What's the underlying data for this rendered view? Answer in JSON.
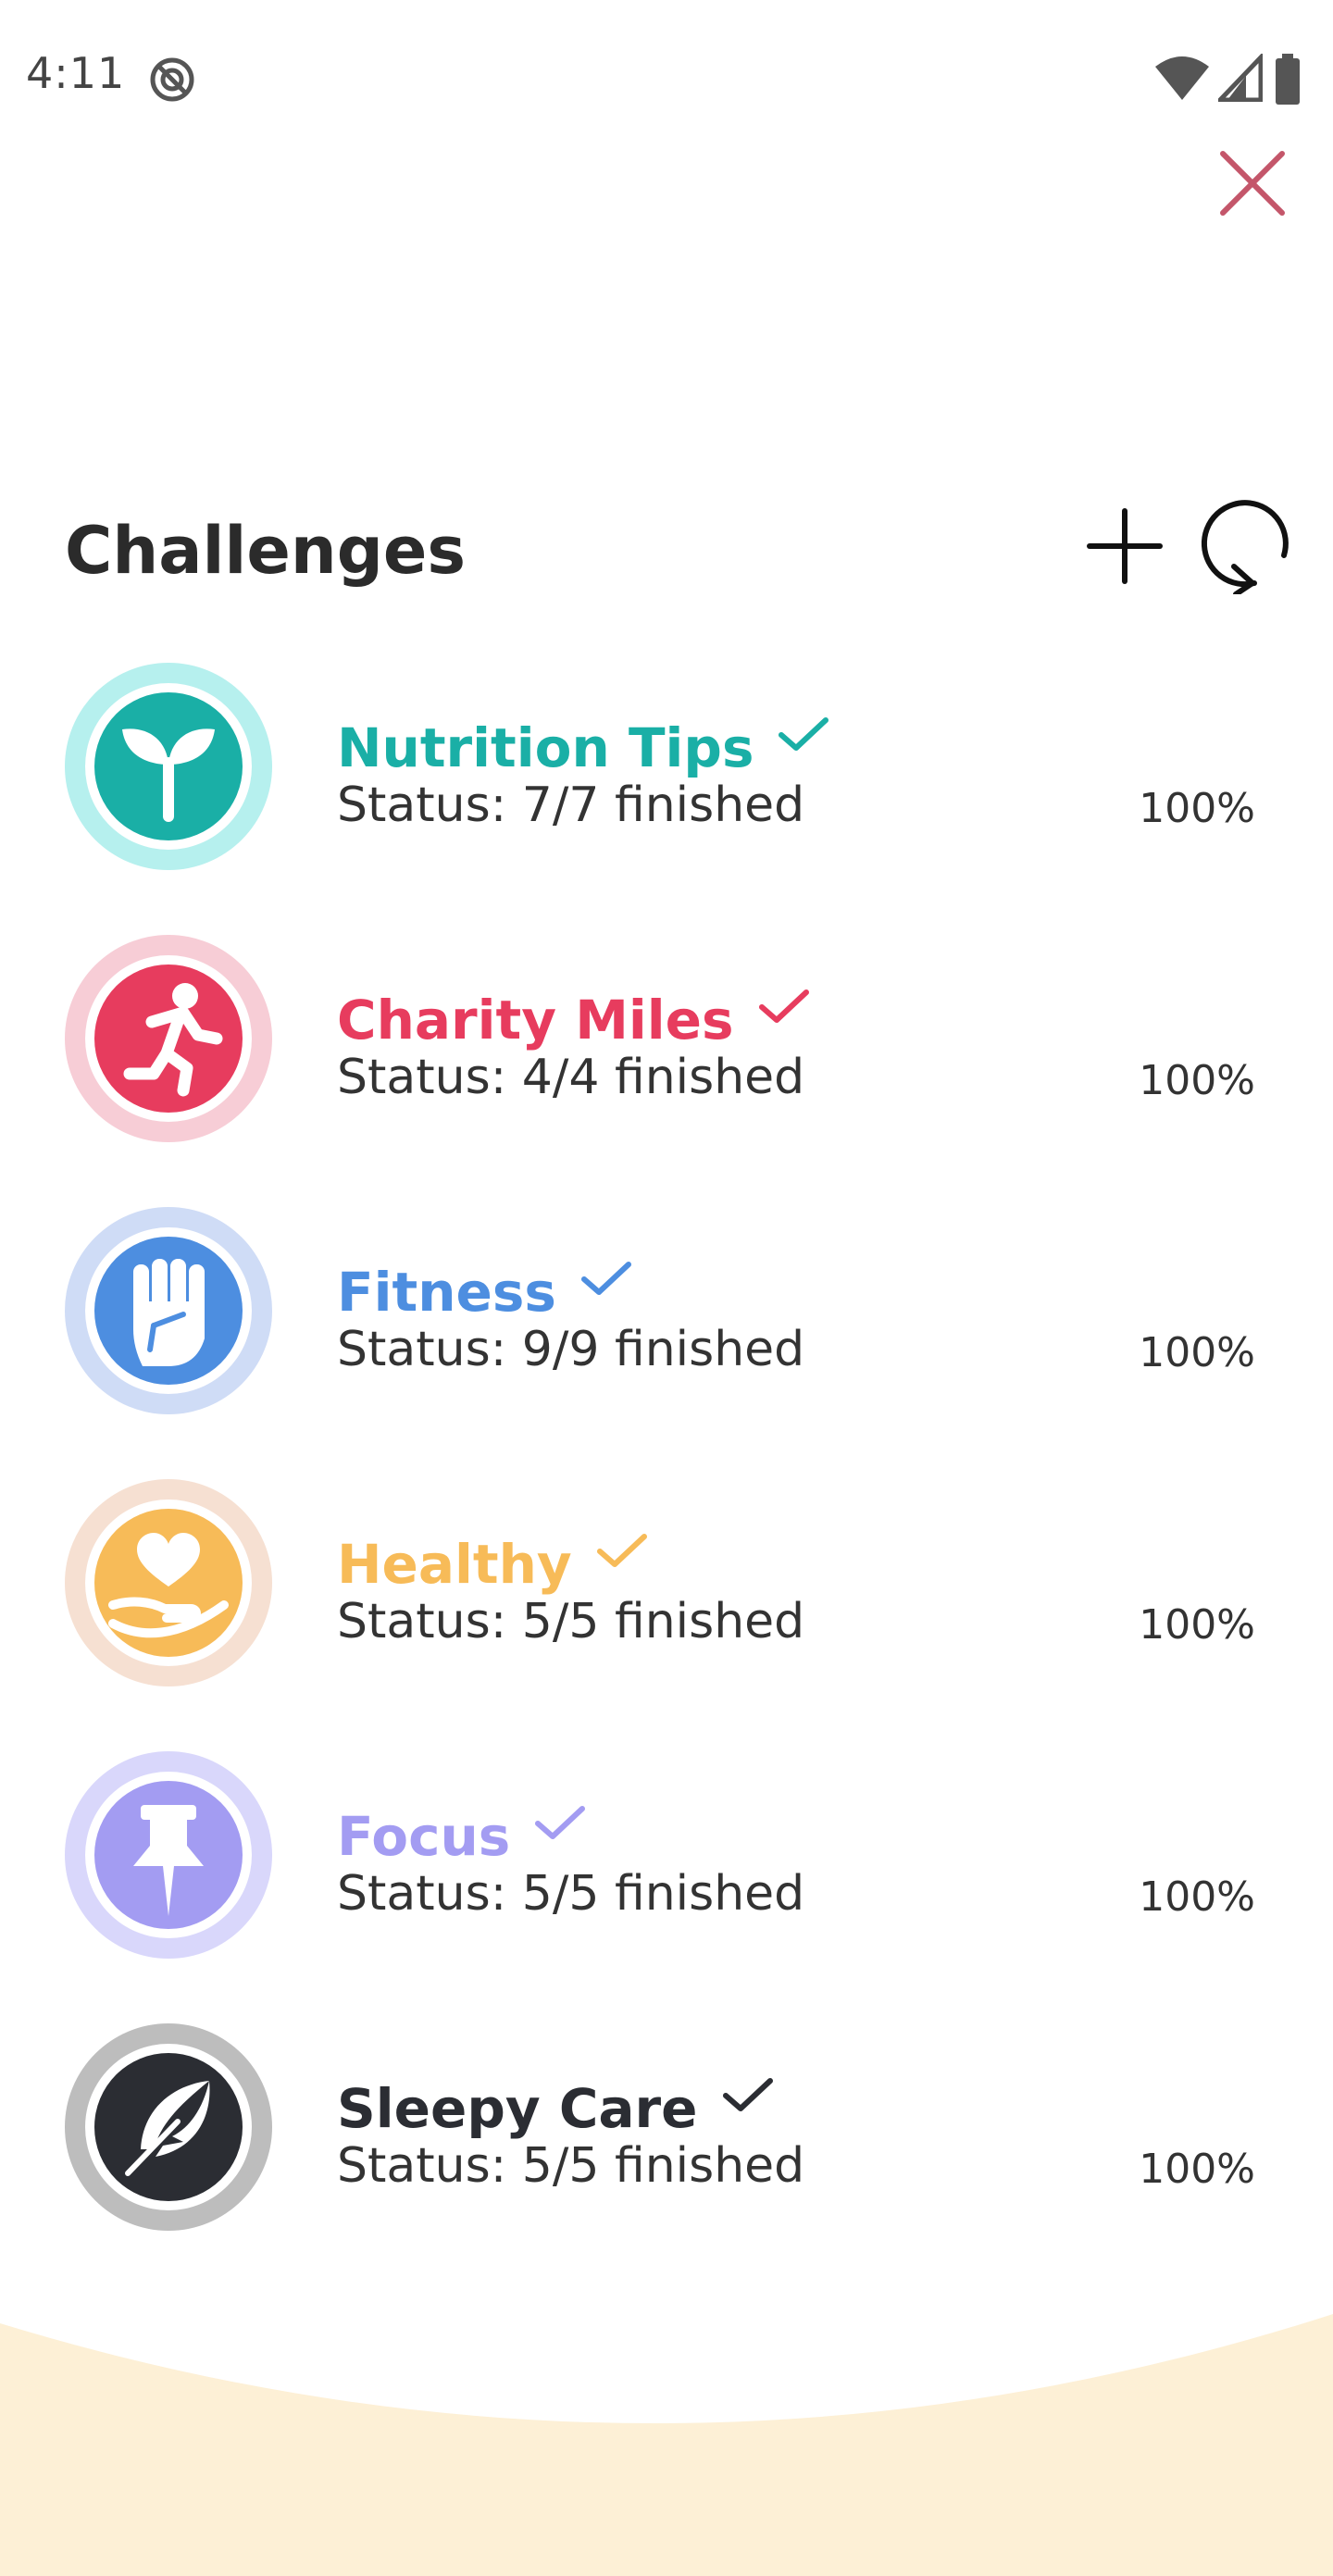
{
  "status_bar": {
    "time": "4:11",
    "icons": [
      "do-not-disturb-icon",
      "wifi-icon",
      "signal-icon",
      "battery-icon"
    ]
  },
  "header": {
    "title": "Challenges",
    "add_icon": "plus-icon",
    "refresh_icon": "refresh-icon",
    "close_icon": "close-icon"
  },
  "colors": {
    "close": "#c4566a",
    "footer": "#fdf0d6",
    "title": "#2b2b2b"
  },
  "challenges": [
    {
      "name": "Nutrition Tips",
      "status": "Status: 7/7 finished",
      "percent": "100%",
      "color": "#1aafa6",
      "ring": "#b6f0ee",
      "icon": "sprout-icon",
      "completed": true
    },
    {
      "name": "Charity Miles",
      "status": "Status: 4/4 finished",
      "percent": "100%",
      "color": "#e73c5e",
      "ring": "#f7cdd6",
      "icon": "runner-icon",
      "completed": true
    },
    {
      "name": "Fitness",
      "status": "Status: 9/9 finished",
      "percent": "100%",
      "color": "#4d8ee0",
      "ring": "#cfdcf6",
      "icon": "fist-icon",
      "completed": true
    },
    {
      "name": "Healthy",
      "status": "Status: 5/5 finished",
      "percent": "100%",
      "color": "#f7bb58",
      "ring": "#f6e0d2",
      "icon": "heart-hand-icon",
      "completed": true
    },
    {
      "name": "Focus",
      "status": "Status: 5/5 finished",
      "percent": "100%",
      "color": "#a39cf2",
      "ring": "#d9d7fb",
      "icon": "pushpin-icon",
      "completed": true
    },
    {
      "name": "Sleepy Care",
      "status": "Status: 5/5 finished",
      "percent": "100%",
      "color": "#2b2d33",
      "ring": "#bdbdbd",
      "icon": "feather-icon",
      "completed": true
    }
  ]
}
